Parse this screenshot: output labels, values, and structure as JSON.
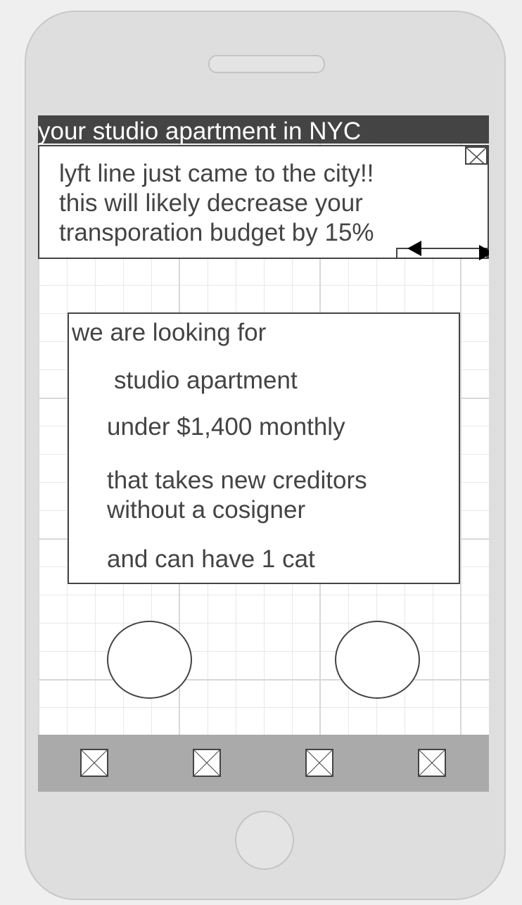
{
  "header": {
    "title": "your studio apartment in NYC"
  },
  "notice": {
    "lines": [
      "lyft line just came to the city!!",
      "this will likely decrease your",
      "transporation budget by 15%"
    ],
    "close_icon": "close-image-placeholder-icon",
    "prev_icon": "arrow-left-icon",
    "next_icon": "arrow-right-icon"
  },
  "criteria": {
    "heading": "we are looking for",
    "items": [
      "studio apartment",
      "under $1,400 monthly",
      "that takes new creditors",
      "without a cosigner",
      "and can have 1 cat"
    ]
  },
  "tabbar": {
    "icons": [
      "image-placeholder-icon",
      "image-placeholder-icon",
      "image-placeholder-icon",
      "image-placeholder-icon"
    ]
  }
}
